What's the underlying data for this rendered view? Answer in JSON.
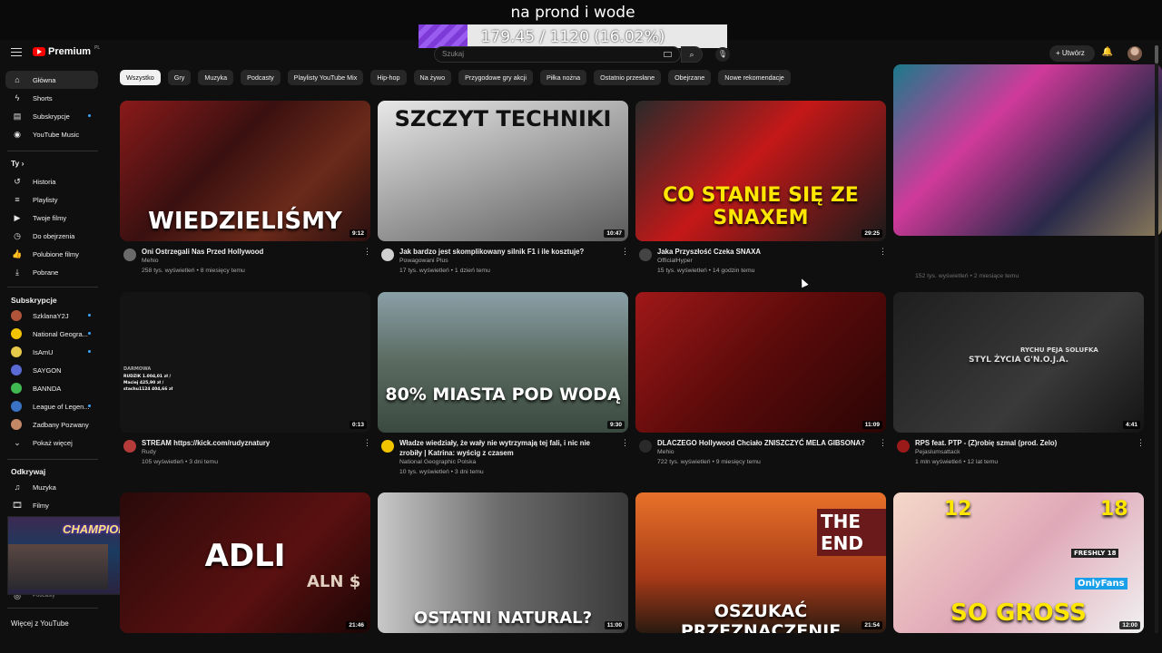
{
  "stream": {
    "title": "na prond i wode",
    "progress_text": "179.45 / 1120 (16.02%)",
    "progress_fraction": 0.1602
  },
  "header": {
    "logo_text": "Premium",
    "logo_sup": "PL",
    "search_placeholder": "Szukaj",
    "create_label": "+ Utwórz",
    "search_icon": "search-icon",
    "mic_icon": "mic-icon",
    "bell_icon": "bell-icon"
  },
  "sidebar": {
    "main": [
      {
        "label": "Główna",
        "icon": "home-icon"
      },
      {
        "label": "Shorts",
        "icon": "shorts-icon"
      },
      {
        "label": "Subskrypcje",
        "icon": "subscriptions-icon"
      },
      {
        "label": "YouTube Music",
        "icon": "music-icon"
      }
    ],
    "you_heading": "Ty",
    "you": [
      {
        "label": "Historia",
        "icon": "history-icon"
      },
      {
        "label": "Playlisty",
        "icon": "playlist-icon"
      },
      {
        "label": "Twoje filmy",
        "icon": "your-videos-icon"
      },
      {
        "label": "Do obejrzenia",
        "icon": "watch-later-icon"
      },
      {
        "label": "Polubione filmy",
        "icon": "like-icon"
      },
      {
        "label": "Pobrane",
        "icon": "download-icon"
      }
    ],
    "subs_heading": "Subskrypcje",
    "subs": [
      {
        "label": "SzklanaY2J",
        "color": "#b0543a"
      },
      {
        "label": "National Geogra...",
        "color": "#f2c400"
      },
      {
        "label": "IsAmU",
        "color": "#e6c84a"
      },
      {
        "label": "SAYGON",
        "color": "#5a6bd6"
      },
      {
        "label": "BANNDA",
        "color": "#3fb950"
      },
      {
        "label": "League of Legen...",
        "color": "#3a73c6"
      },
      {
        "label": "Zadbany Pozwany",
        "color": "#c48866"
      }
    ],
    "show_more": "Pokaż więcej",
    "explore_heading": "Odkrywaj",
    "explore": [
      {
        "label": "Muzyka",
        "icon": "music-note-icon"
      },
      {
        "label": "Filmy",
        "icon": "film-icon"
      }
    ],
    "podcasts_label": "Podcasty",
    "more_heading": "Więcej z YouTube"
  },
  "overlay": {
    "text": "CHAMPIONS LEAGUE"
  },
  "chips": [
    "Wszystko",
    "Gry",
    "Muzyka",
    "Podcasty",
    "Playlisty YouTube Mix",
    "Hip-hop",
    "Na żywo",
    "Przygodowe gry akcji",
    "Piłka nożna",
    "Ostatnio przesłane",
    "Obejrzane",
    "Nowe rekomendacje"
  ],
  "videos": [
    {
      "title": "Oni Ostrzegali Nas Przed Hollywood",
      "channel": "Mehio",
      "meta": "258 tys. wyświetleń • 8 miesięcy temu",
      "duration": "9:12",
      "thumb_text": "WIEDZIELIŚMY"
    },
    {
      "title": "Jak bardzo jest skomplikowany silnik F1 i ile kosztuje?",
      "channel": "Powagowani Plus",
      "meta": "17 tys. wyświetleń • 1 dzień temu",
      "duration": "10:47",
      "thumb_text": "SZCZYT TECHNIKI"
    },
    {
      "title": "Jaka Przyszłość Czeka SNAXA",
      "channel": "OfficialHyper",
      "meta": "15 tys. wyświetleń • 14 godzin temu",
      "duration": "29:25",
      "thumb_text": "CO STANIE SIĘ ZE SNAXEM"
    },
    {
      "title": "",
      "channel": "",
      "meta": "152 tys. wyświetleń • 2 miesiące temu",
      "duration": "",
      "thumb_text": ""
    },
    {
      "title": "STREAM https://kick.com/rudyznatury",
      "channel": "Rudy",
      "meta": "105 wyświetleń • 3 dni temu",
      "duration": "0:13",
      "thumb_text": ""
    },
    {
      "title": "Władze wiedziały, że wały nie wytrzymają tej fali, i nic nie zrobiły | Katrina: wyścig z czasem",
      "channel": "National Geographic Polska",
      "meta": "10 tys. wyświetleń • 3 dni temu",
      "duration": "9:30",
      "thumb_text": "80% MIASTA POD WODĄ"
    },
    {
      "title": "DLACZEGO Hollywood Chciało ZNISZCZYĆ MELA GIBSONA?",
      "channel": "Mehio",
      "meta": "722 tys. wyświetleń • 9 miesięcy temu",
      "duration": "11:09",
      "thumb_text": ""
    },
    {
      "title": "RPS feat. PTP - (Z)robię szmal (prod. Zelo)",
      "channel": "Pejaslumsattack",
      "meta": "1 mln wyświetleń • 12 lat temu",
      "duration": "4:41",
      "thumb_text": "STYL ŻYCIA G'N.O.J.A."
    },
    {
      "title": "",
      "channel": "",
      "meta": "",
      "duration": "21:46",
      "thumb_text": "ADLI"
    },
    {
      "title": "",
      "channel": "",
      "meta": "",
      "duration": "11:00",
      "thumb_text": "OSTATNI NATURAL?"
    },
    {
      "title": "",
      "channel": "",
      "meta": "",
      "duration": "21:54",
      "thumb_text": "OSZUKAĆ PRZEZNACZENIE"
    },
    {
      "title": "",
      "channel": "",
      "meta": "",
      "duration": "12:00",
      "thumb_text": "SO GROSS"
    }
  ],
  "thumb_extras": {
    "v4_brand": "RYCHU PEJA SOLUFKA",
    "v8_sign": "THE END",
    "v11_age1": "12",
    "v11_age2": "18",
    "v11_badge": "FRESHLY 18",
    "v11_brand": "OnlyFans",
    "v4_overlay": "RUDZIK 1.004,01 zł / Maciej 425,90 zł / stachu1124 404,66 zł",
    "v8_sub": "ALN $",
    "stream_label": "DARMOWA"
  }
}
